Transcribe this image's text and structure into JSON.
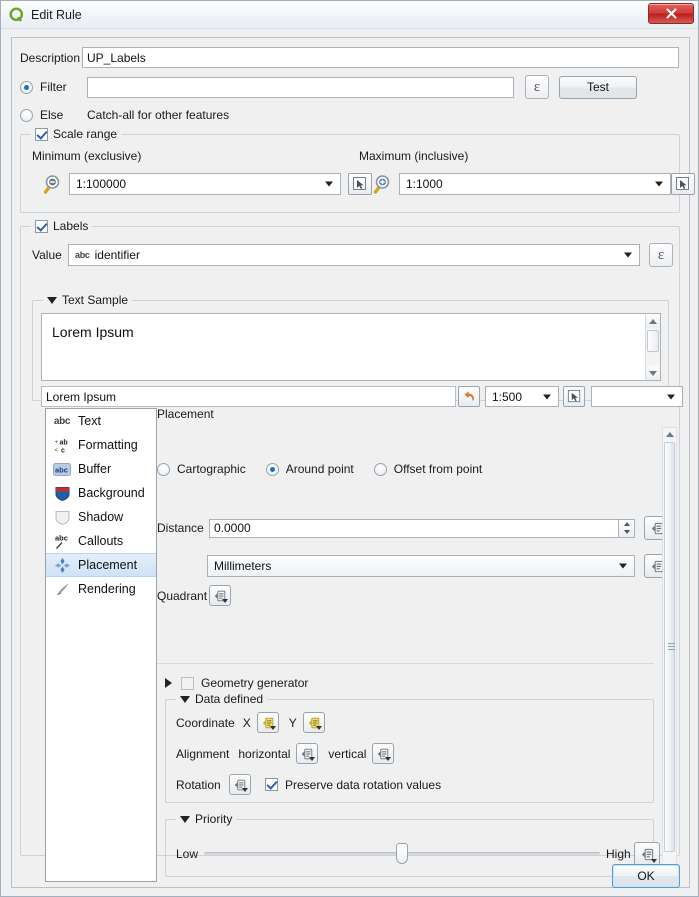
{
  "window": {
    "title": "Edit Rule",
    "logo_icon": "qgis-logo-icon",
    "close_label": "✕"
  },
  "form": {
    "description_label": "Description",
    "description_value": "UP_Labels",
    "filter_label": "Filter",
    "filter_value": "",
    "filter_selected": true,
    "expression_button_label": "ε",
    "test_button_label": "Test",
    "else_label": "Else",
    "else_hint": "Catch-all for other features",
    "else_selected": false
  },
  "scale_range": {
    "group_label": "Scale range",
    "checked": true,
    "minimum_label": "Minimum (exclusive)",
    "minimum_value": "1:100000",
    "minimum_icon": "zoom-out-icon",
    "minimum_pick_icon": "map-scale-picker-icon",
    "maximum_label": "Maximum (inclusive)",
    "maximum_value": "1:1000",
    "maximum_icon": "zoom-in-icon",
    "maximum_pick_icon": "map-scale-picker-icon"
  },
  "labels": {
    "group_label": "Labels",
    "checked": true,
    "value_label": "Value",
    "value_prefix": "abc",
    "value_value": "identifier",
    "expression_button_label": "ε"
  },
  "text_sample": {
    "group_label": "Text Sample",
    "expanded": true,
    "sample_text": "Lorem Ipsum",
    "preview_value": "Lorem Ipsum",
    "revert_icon": "revert-arrow-icon",
    "scale_value": "1:500",
    "pick_icon": "map-scale-picker-icon",
    "substitution_value": ""
  },
  "categories": {
    "selected": "Placement",
    "items": [
      {
        "label": "Text",
        "icon": "text-abc-icon"
      },
      {
        "label": "Formatting",
        "icon": "formatting-icon"
      },
      {
        "label": "Buffer",
        "icon": "buffer-abc-icon"
      },
      {
        "label": "Background",
        "icon": "background-shield-icon"
      },
      {
        "label": "Shadow",
        "icon": "shadow-shield-icon"
      },
      {
        "label": "Callouts",
        "icon": "callouts-icon"
      },
      {
        "label": "Placement",
        "icon": "placement-diamonds-icon"
      },
      {
        "label": "Rendering",
        "icon": "rendering-brush-icon"
      }
    ]
  },
  "placement": {
    "heading": "Placement",
    "modes": [
      {
        "label": "Cartographic",
        "selected": false
      },
      {
        "label": "Around point",
        "selected": true
      },
      {
        "label": "Offset from point",
        "selected": false
      }
    ],
    "distance_label": "Distance",
    "distance_value": "0.0000",
    "distance_dd_icon": "data-defined-override-icon",
    "units_value": "Millimeters",
    "units_dd_icon": "data-defined-override-icon",
    "quadrant_label": "Quadrant",
    "quadrant_dd_icon": "data-defined-override-icon"
  },
  "geometry_generator": {
    "label": "Geometry generator",
    "checked": false,
    "expanded": false
  },
  "data_defined": {
    "group_label": "Data defined",
    "expanded": true,
    "coordinate_label": "Coordinate",
    "coordinate_x_label": "X",
    "coordinate_x_icon": "data-defined-override-active-icon",
    "coordinate_y_label": "Y",
    "coordinate_y_icon": "data-defined-override-active-icon",
    "alignment_label": "Alignment",
    "alignment_horizontal_label": "horizontal",
    "alignment_horizontal_icon": "data-defined-override-icon",
    "alignment_vertical_label": "vertical",
    "alignment_vertical_icon": "data-defined-override-icon",
    "rotation_label": "Rotation",
    "rotation_icon": "data-defined-override-icon",
    "preserve_rotation_label": "Preserve data rotation values",
    "preserve_rotation_checked": true
  },
  "priority": {
    "group_label": "Priority",
    "expanded": true,
    "low_label": "Low",
    "high_label": "High",
    "value_percent": 50,
    "dd_icon": "data-defined-override-icon"
  },
  "footer": {
    "ok_label": "OK"
  },
  "colors": {
    "accent_blue": "#1573c4",
    "selection_blue": "#cfe2f7",
    "close_red": "#c62b26",
    "dd_active_yellow": "#f2dd6e",
    "qgis_green": "#6aa626"
  }
}
